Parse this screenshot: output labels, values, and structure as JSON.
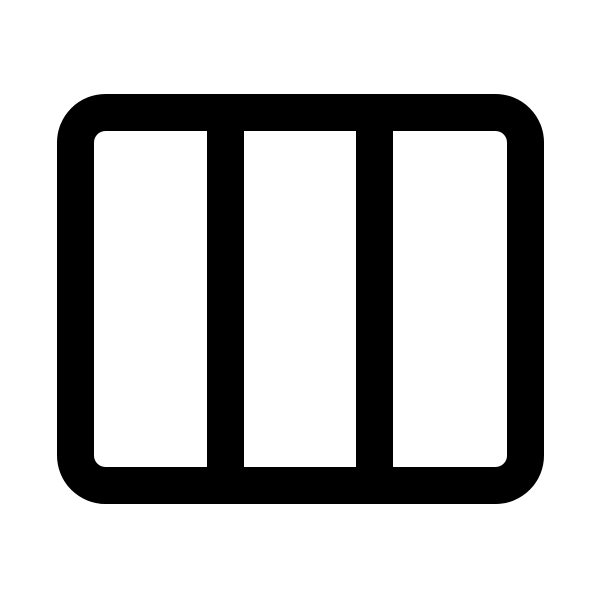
{
  "icon": {
    "name": "columns-three-icon",
    "color": "#000000",
    "background": "#ffffff"
  }
}
